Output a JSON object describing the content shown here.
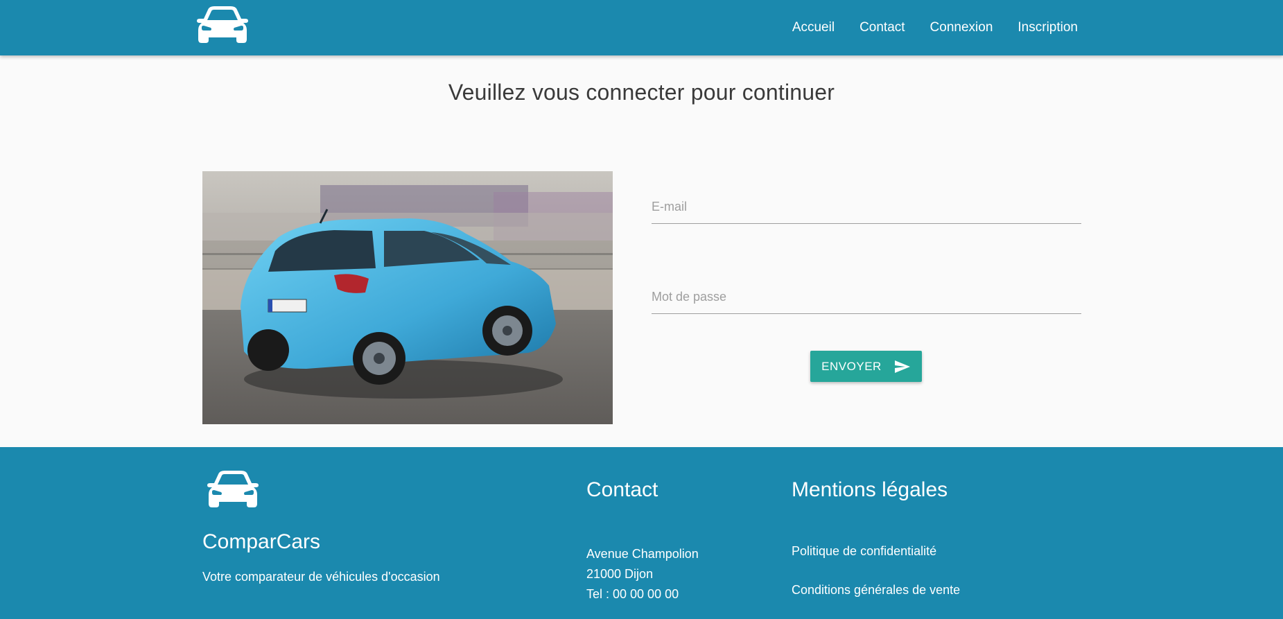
{
  "brand": {
    "name": "ComparCars",
    "tagline": "Votre comparateur de véhicules d'occasion"
  },
  "colors": {
    "primary": "#1b89ae",
    "button": "#26a69a",
    "background": "#fafafa"
  },
  "nav": {
    "logo_icon": "car-icon",
    "links": [
      {
        "label": "Accueil"
      },
      {
        "label": "Contact"
      },
      {
        "label": "Connexion"
      },
      {
        "label": "Inscription"
      }
    ]
  },
  "main": {
    "heading": "Veuillez vous connecter pour continuer",
    "image_icon": "car-photo",
    "form": {
      "email_placeholder": "E-mail",
      "email_value": "",
      "password_placeholder": "Mot de passe",
      "password_value": "",
      "submit_label": "ENVOYER",
      "submit_icon": "send-icon"
    }
  },
  "footer": {
    "contact": {
      "title": "Contact",
      "lines": [
        "Avenue Champolion",
        "21000 Dijon",
        "Tel : 00 00 00 00"
      ]
    },
    "legal": {
      "title": "Mentions légales",
      "links": [
        "Politique de confidentialité",
        "Conditions générales de vente"
      ]
    }
  }
}
